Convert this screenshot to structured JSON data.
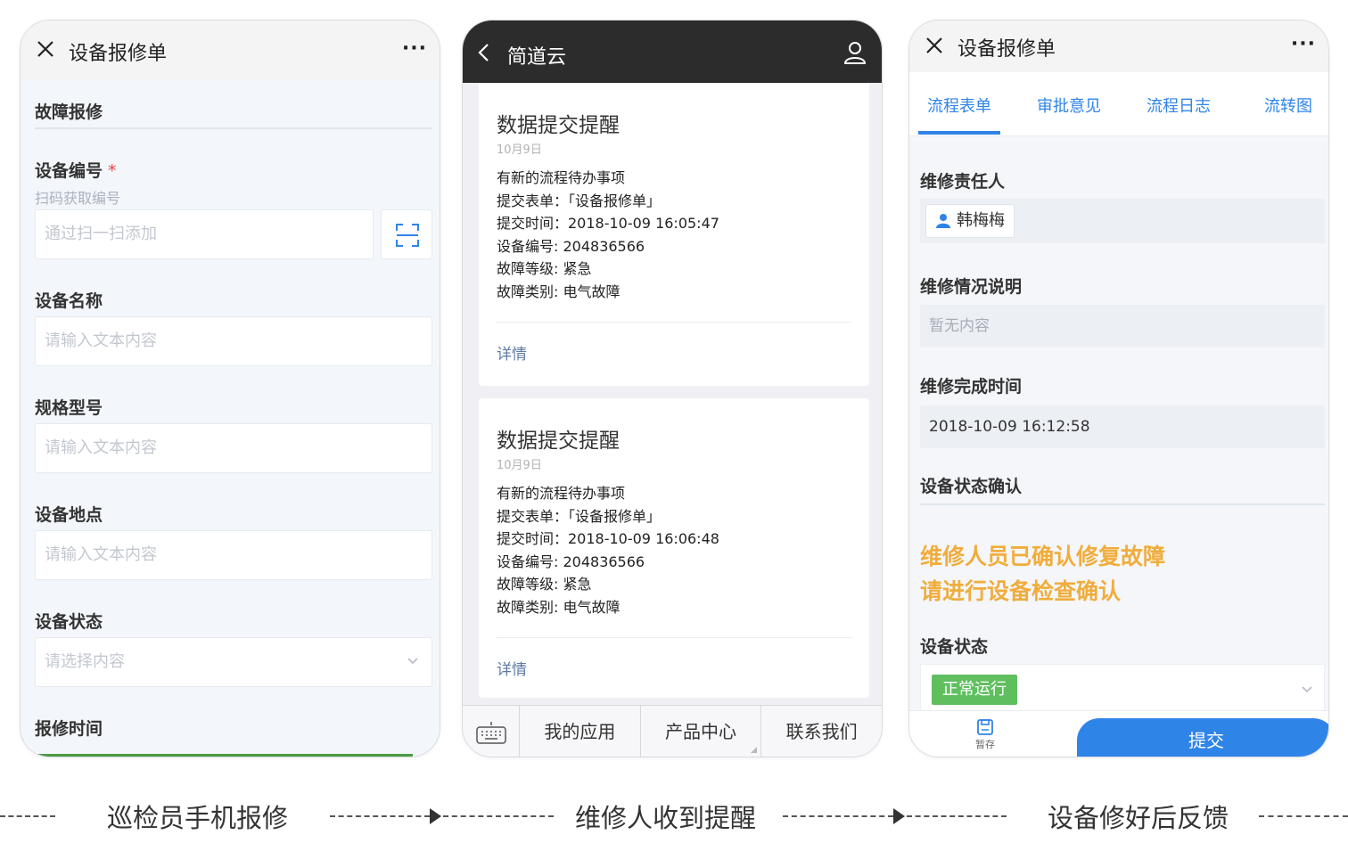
{
  "phone1": {
    "nav": {
      "title": "设备报修单",
      "more": "···"
    },
    "section": "故障报修",
    "fields": {
      "device_no": {
        "label": "设备编号",
        "required": "*",
        "hint": "扫码获取编号",
        "placeholder": "通过扫一扫添加"
      },
      "device_name": {
        "label": "设备名称",
        "placeholder": "请输入文本内容"
      },
      "model": {
        "label": "规格型号",
        "placeholder": "请输入文本内容"
      },
      "location": {
        "label": "设备地点",
        "placeholder": "请输入文本内容"
      },
      "status": {
        "label": "设备状态",
        "placeholder": "请选择内容"
      },
      "report_time": {
        "label": "报修时间"
      }
    }
  },
  "phone2": {
    "nav": {
      "title": "简道云"
    },
    "cards": [
      {
        "title": "数据提交提醒",
        "date": "10月9日",
        "lines": [
          "有新的流程待办事项",
          "提交表单：「设备报修单」",
          "提交时间：2018-10-09 16:05:47",
          "设备编号: 204836566",
          "故障等级: 紧急",
          "故障类别: 电气故障"
        ],
        "detail": "详情"
      },
      {
        "title": "数据提交提醒",
        "date": "10月9日",
        "lines": [
          "有新的流程待办事项",
          "提交表单：「设备报修单」",
          "提交时间：2018-10-09 16:06:48",
          "设备编号: 204836566",
          "故障等级: 紧急",
          "故障类别: 电气故障"
        ],
        "detail": "详情"
      }
    ],
    "tabbar": [
      "我的应用",
      "产品中心",
      "联系我们"
    ]
  },
  "phone3": {
    "nav": {
      "title": "设备报修单",
      "more": "···"
    },
    "tabs": [
      "流程表单",
      "审批意见",
      "流程日志",
      "流转图"
    ],
    "repair_person": {
      "label": "维修责任人",
      "name": "韩梅梅"
    },
    "repair_desc": {
      "label": "维修情况说明",
      "value": "暂无内容"
    },
    "repair_done_time": {
      "label": "维修完成时间",
      "value": "2018-10-09  16:12:58"
    },
    "confirm_section": "设备状态确认",
    "notice_lines": [
      "维修人员已确认修复故障",
      "请进行设备检查确认"
    ],
    "device_status": {
      "label": "设备状态",
      "value": "正常运行"
    },
    "save_label": "暂存",
    "submit_label": "提交"
  },
  "flow": {
    "captions": [
      "巡检员手机报修",
      "维修人收到提醒",
      "设备修好后反馈"
    ]
  },
  "colors": {
    "accent_blue": "#2f84e8",
    "notice_orange": "#f0ad3c",
    "status_green": "#5fbf5f",
    "dark_nav": "#2c2c2c"
  }
}
